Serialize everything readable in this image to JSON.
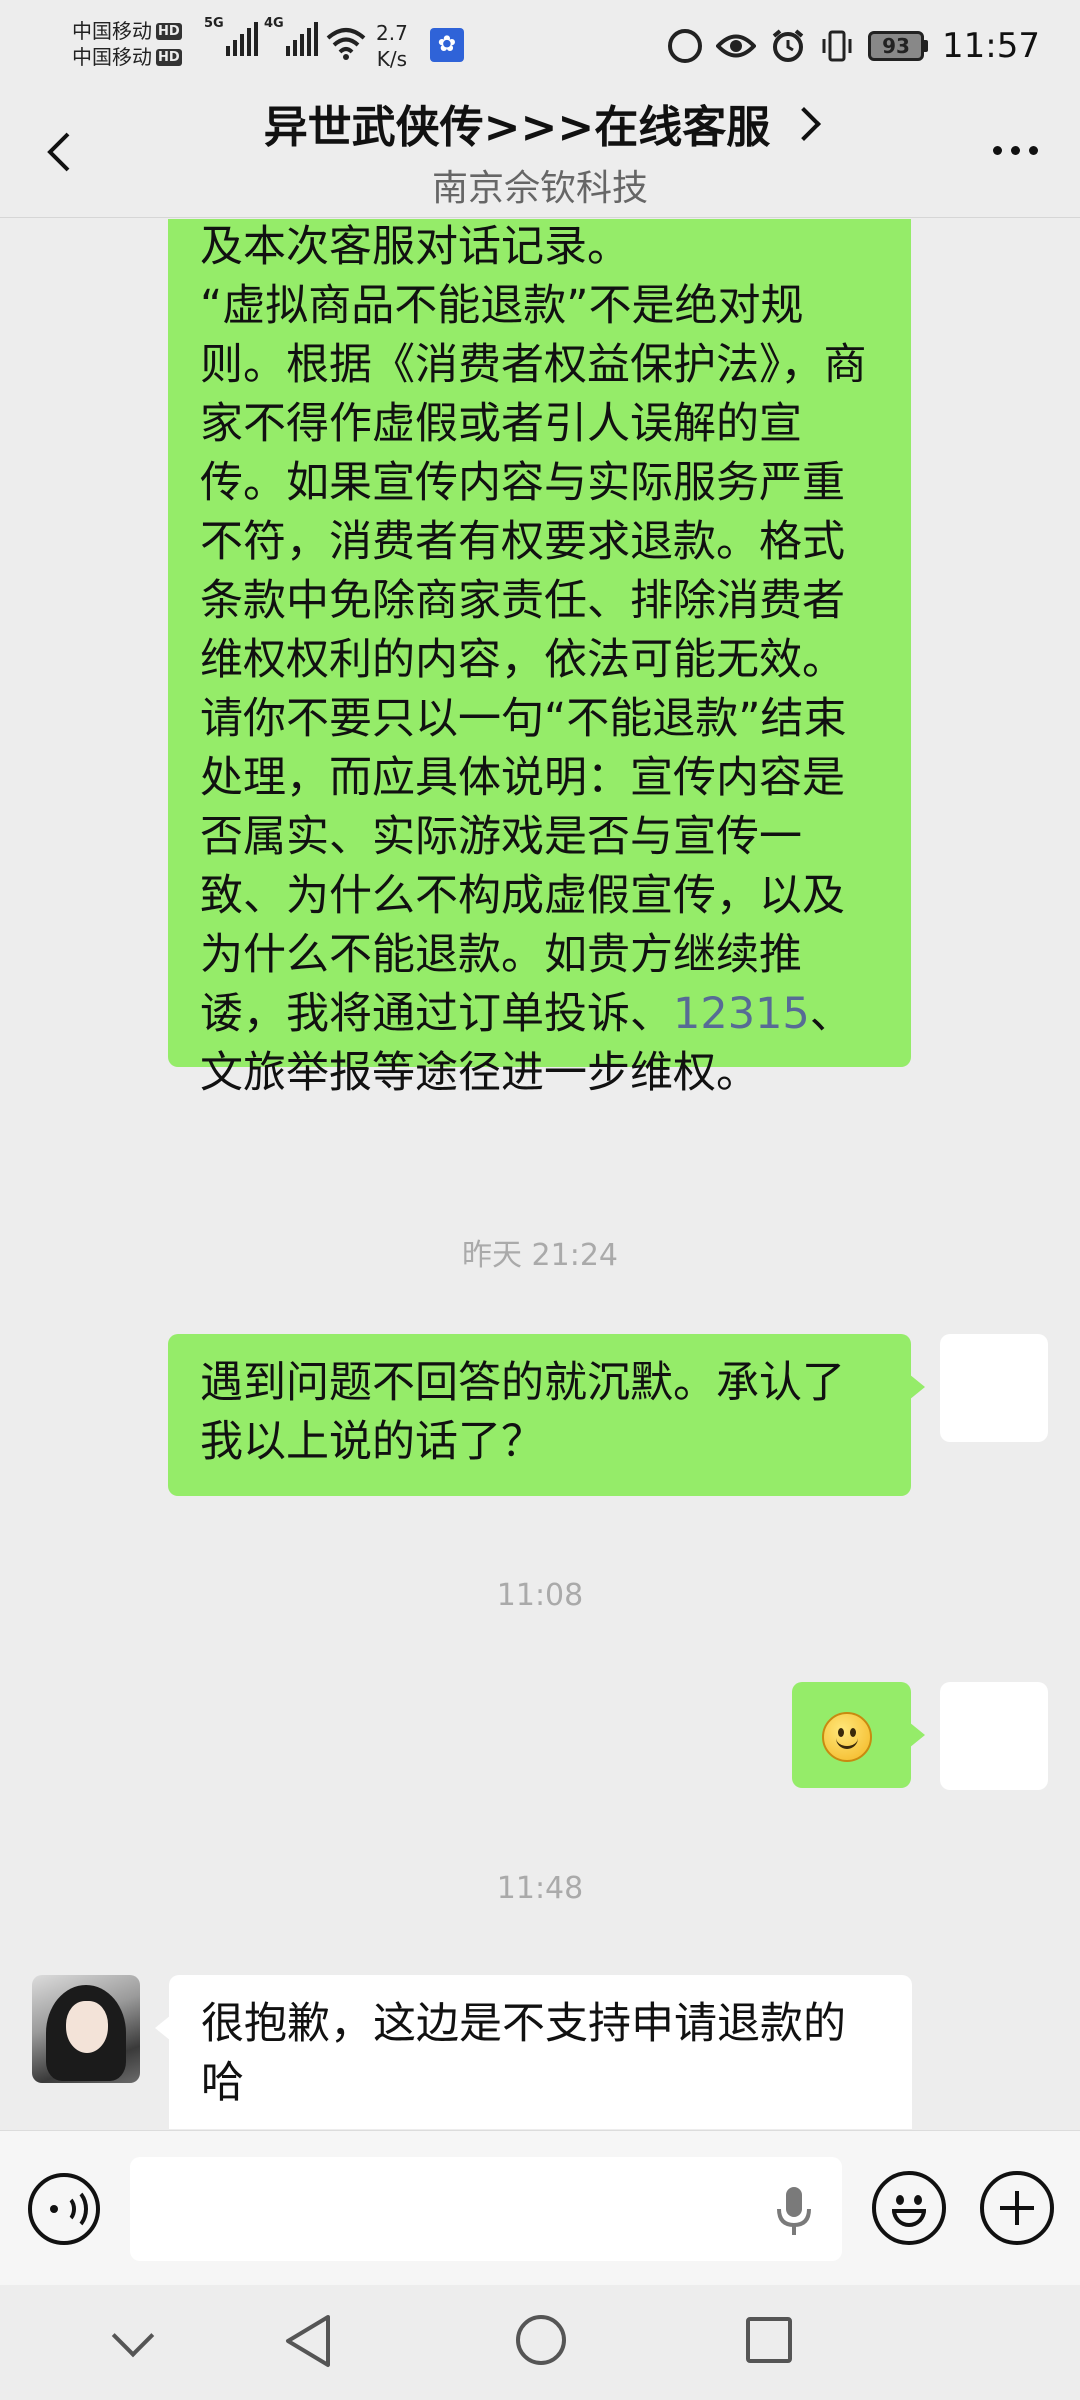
{
  "status_bar": {
    "carrier1": "中国移动",
    "carrier2": "中国移动",
    "hd": "HD",
    "net1": "5G",
    "net2": "4G",
    "speed_value": "2.7",
    "speed_unit": "K/s",
    "battery": "93",
    "time": "11:57"
  },
  "header": {
    "title": "异世武侠传>>>在线客服",
    "subtitle": "南京佘钦科技"
  },
  "messages": [
    {
      "sender": "me",
      "text_before": "截图、实际游戏画面、充值记录以及本次客服对话记录。\n“虚拟商品不能退款”不是绝对规则。根据《消费者权益保护法》，商家不得作虚假或者引人误解的宣传。如果宣传内容与实际服务严重不符，消费者有权要求退款。格式条款中免除商家责任、排除消费者维权权利的内容，依法可能无效。请你不要只以一句“不能退款”结束处理，而应具体说明：宣传内容是否属实、实际游戏是否与宣传一致、为什么不构成虚假宣传，以及为什么不能退款。如贵方继续推诿，我将通过订单投诉、",
      "link": "12315",
      "text_after": "、文旅举报等途径进一步维权。"
    },
    {
      "timestamp": "昨天 21:24"
    },
    {
      "sender": "me",
      "text": "遇到问题不回答的就沉默。承认了我以上说的话了？"
    },
    {
      "timestamp": "11:08"
    },
    {
      "sender": "me",
      "emoji": "smile"
    },
    {
      "timestamp": "11:48"
    },
    {
      "sender": "other",
      "text": "很抱歉，这边是不支持申请退款的哈"
    }
  ],
  "input": {
    "placeholder": "",
    "value": ""
  },
  "colors": {
    "my_bubble": "#95ec69",
    "other_bubble": "#ffffff",
    "background": "#ededed",
    "link": "#576b95"
  }
}
